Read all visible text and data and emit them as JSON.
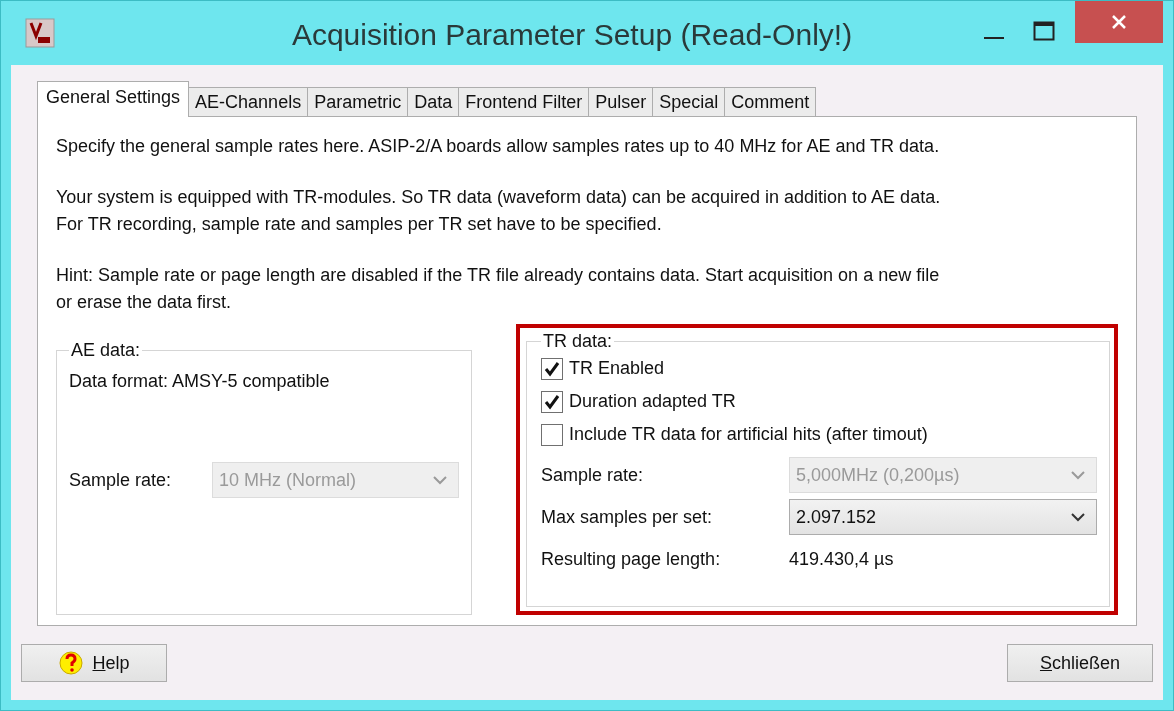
{
  "window": {
    "title": "Acquisition Parameter Setup (Read-Only!)"
  },
  "tabs": [
    {
      "label": "General Settings",
      "selected": true
    },
    {
      "label": "AE-Channels",
      "selected": false
    },
    {
      "label": "Parametric",
      "selected": false
    },
    {
      "label": "Data",
      "selected": false
    },
    {
      "label": "Frontend Filter",
      "selected": false
    },
    {
      "label": "Pulser",
      "selected": false
    },
    {
      "label": "Special",
      "selected": false
    },
    {
      "label": "Comment",
      "selected": false
    }
  ],
  "intro": [
    "Specify the general sample rates here. ASIP-2/A boards allow samples rates up to 40 MHz for AE and TR data.",
    "Your system is equipped with TR-modules. So TR data (waveform data) can be acquired in addition to AE data.\nFor TR recording, sample rate and samples per TR set have to be specified.",
    "Hint: Sample rate or page length are disabled if the TR file already contains data. Start acquisition on a new file\nor erase the data first."
  ],
  "ae_data": {
    "title": "AE data:",
    "format_text": "Data format: AMSY-5 compatible",
    "sample_rate": {
      "label": "Sample rate:",
      "value": "10 MHz (Normal)",
      "disabled": true
    }
  },
  "tr_data": {
    "title": "TR data:",
    "highlighted": true,
    "checkboxes": [
      {
        "label": "TR Enabled",
        "checked": true
      },
      {
        "label": "Duration adapted TR",
        "checked": true
      },
      {
        "label": "Include TR data for artificial hits (after timout)",
        "checked": false
      }
    ],
    "sample_rate": {
      "label": "Sample rate:",
      "value": "5,000MHz  (0,200µs)",
      "disabled": true
    },
    "max_samples": {
      "label": "Max samples per set:",
      "value": "2.097.152",
      "disabled": false
    },
    "page_length": {
      "label": "Resulting page length:",
      "value": "419.430,4 µs"
    }
  },
  "buttons": [
    {
      "label": "Help",
      "kind": "help"
    },
    {
      "label": "Schließen",
      "kind": "plain"
    }
  ]
}
